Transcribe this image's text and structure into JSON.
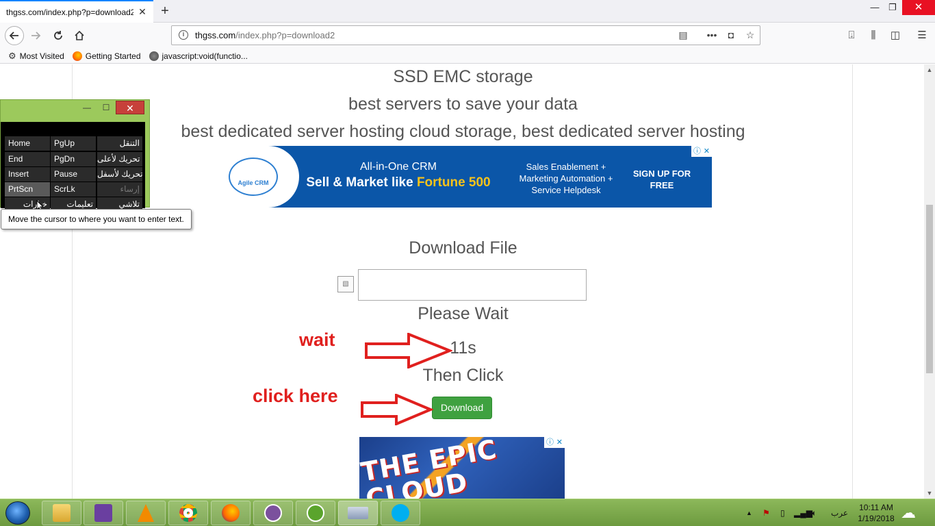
{
  "browser": {
    "tab_title": "thgss.com/index.php?p=download2",
    "url_host": "thgss.com",
    "url_path": "/index.php?p=download2",
    "bookmarks": [
      {
        "label": "Most Visited",
        "icon": "gear-icon"
      },
      {
        "label": "Getting Started",
        "icon": "firefox-icon"
      },
      {
        "label": "javascript:void(functio...",
        "icon": "globe-icon"
      }
    ]
  },
  "page": {
    "line1": "SSD EMC storage",
    "line2": "best servers to save your data",
    "line3": "best dedicated server hosting cloud storage, best dedicated server hosting",
    "ad_top": {
      "brand": "Agile CRM",
      "headline1": "All-in-One CRM",
      "headline2_pre": "Sell & Market like ",
      "headline2_hl": "Fortune 500",
      "mid": "Sales Enablement + Marketing Automation + Service Helpdesk",
      "cta": "SIGN UP FOR FREE"
    },
    "download_title": "Download File",
    "please_wait": "Please Wait",
    "countdown": "11s",
    "then_click": "Then Click",
    "download_button": "Download",
    "ad_bottom_text": "THE EPIC CLOUD"
  },
  "annotations": {
    "wait": "wait",
    "click_here": "click here",
    "color": "#e0201e"
  },
  "osk": {
    "keys": [
      [
        "Home",
        "PgUp",
        "التنقل"
      ],
      [
        "End",
        "PgDn",
        "تحريك لأعلى"
      ],
      [
        "Insert",
        "Pause",
        "تحريك لأسفل"
      ],
      [
        "PrtScn",
        "ScrLk",
        "إرساء"
      ],
      [
        "خيارات",
        "تعليمات",
        "تلاشي"
      ]
    ]
  },
  "tooltip": "Move the cursor to where you want to enter text.",
  "taskbar": {
    "apps": [
      "explorer",
      "visual-studio",
      "vlc",
      "chrome",
      "firefox",
      "viber",
      "utorrent",
      "onscreen-keyboard",
      "skype"
    ],
    "language": "عرب",
    "time": "10:11 AM",
    "date": "1/19/2018"
  },
  "colors": {
    "accent": "#0a84ff",
    "download_green": "#3fa140",
    "taskbar_green": "#7da94c"
  }
}
